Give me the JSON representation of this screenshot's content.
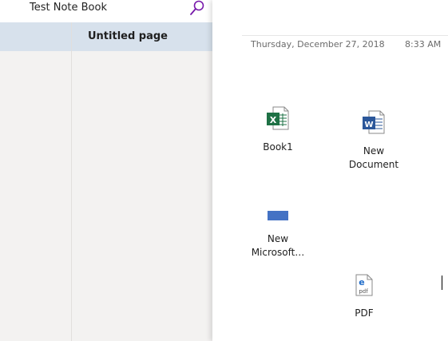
{
  "header": {
    "notebook_title": "Test Note Book",
    "search_icon": "search-icon"
  },
  "pages": {
    "items": [
      {
        "label": "Untitled page",
        "selected": true
      }
    ]
  },
  "canvas": {
    "date": "Thursday, December 27, 2018",
    "time": "8:33 AM",
    "attachments": [
      {
        "label": "Book1",
        "icon": "excel-file-icon"
      },
      {
        "label": "New Document",
        "line1": "New",
        "line2": "Document",
        "icon": "word-file-icon"
      },
      {
        "label": "New Microsoft…",
        "line1": "New",
        "line2": "Microsoft…",
        "icon": "generic-file-icon"
      },
      {
        "label": "PDF",
        "icon": "pdf-file-icon"
      }
    ]
  },
  "colors": {
    "selection": "#d7e1ec",
    "pane_bg": "#f3f2f1",
    "accent_purple": "#7719aa",
    "excel_green": "#1e7145",
    "word_blue": "#2b579a",
    "generic_blue": "#4472c4"
  }
}
